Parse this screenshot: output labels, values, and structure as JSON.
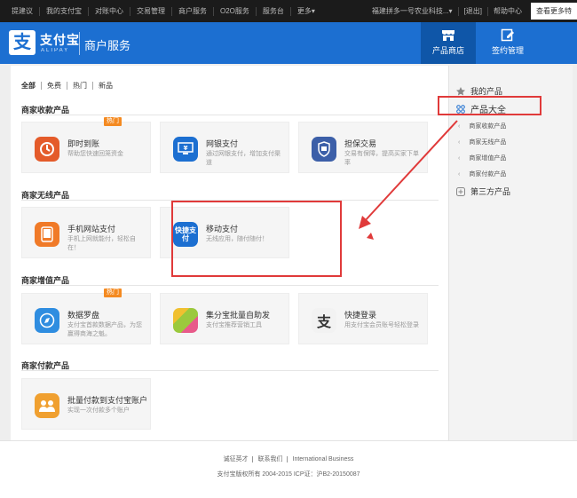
{
  "topnav": {
    "left": [
      "提建议",
      "我的支付宝",
      "对账中心",
      "交易管理",
      "商户服务",
      "O2O服务",
      "服务台",
      "更多▾"
    ],
    "right": [
      "福建拼多一号农业科技...▾",
      "[退出]",
      "帮助中心"
    ],
    "more": "查看更多特"
  },
  "header": {
    "logo_glyph": "支",
    "brand": "支付宝",
    "brand_sub": "ALIPAY",
    "service": "商户服务",
    "tabs": [
      {
        "label": "产品商店",
        "icon": "shop-icon"
      },
      {
        "label": "签约管理",
        "icon": "edit-icon"
      }
    ]
  },
  "filter": [
    "全部",
    "免费",
    "热门",
    "新品"
  ],
  "sections": [
    {
      "title": "商家收款产品",
      "cards": [
        {
          "title": "即时到账",
          "desc": "帮助您快速回笼资金",
          "badge": "热门",
          "icon": "instant-pay-icon",
          "color": "#e45b2a"
        },
        {
          "title": "网银支付",
          "desc": "通过网银支付，增加支付渠道",
          "icon": "bank-pay-icon",
          "color": "#1c6fd1"
        },
        {
          "title": "担保交易",
          "desc": "交易有保障，提高买家下单率",
          "icon": "guarantee-icon",
          "color": "#3c5fa8"
        }
      ]
    },
    {
      "title": "商家无线产品",
      "cards": [
        {
          "title": "手机网站支付",
          "desc": "手机上网就能付，轻松自在！",
          "icon": "mobile-web-pay-icon",
          "color": "#f07a28"
        },
        {
          "title": "移动支付",
          "desc": "无线应用，随付随付！",
          "icon": "mobile-pay-icon",
          "icon_text": "快捷支付",
          "color": "#1c6fd1"
        }
      ]
    },
    {
      "title": "商家增值产品",
      "cards": [
        {
          "title": "数据罗盘",
          "desc": "支付宝首款数据产品，为您赢得商海之魁。",
          "badge": "热门",
          "icon": "compass-icon",
          "color": "#2f8de0"
        },
        {
          "title": "集分宝批量自助发",
          "desc": "支付宝推荐营销工具",
          "icon": "points-icon",
          "color": "#9bc93d"
        },
        {
          "title": "快捷登录",
          "desc": "用支付宝会员账号轻松登录",
          "icon": "alipay-login-icon",
          "icon_text": "支",
          "color": "#f2f2f2"
        }
      ]
    },
    {
      "title": "商家付款产品",
      "cards": [
        {
          "title": "批量付款到支付宝账户",
          "desc": "实现一次付款多个账户",
          "icon": "batch-pay-icon",
          "color": "#f0a030"
        }
      ]
    }
  ],
  "sidebar": {
    "my_products": "我的产品",
    "all_products": "产品大全",
    "subs": [
      "商家收款产品",
      "商家无线产品",
      "商家增值产品",
      "商家付款产品"
    ],
    "third_party": "第三方产品"
  },
  "footer": {
    "links": [
      "诚征英才",
      "联系我们",
      "International Business"
    ],
    "copyright": "支付宝版权所有 2004-2015 ICP证：沪B2-20150087"
  },
  "colors": {
    "brand": "#1c6fd1",
    "badge": "#f48a21",
    "annotation": "#e03a3a"
  }
}
